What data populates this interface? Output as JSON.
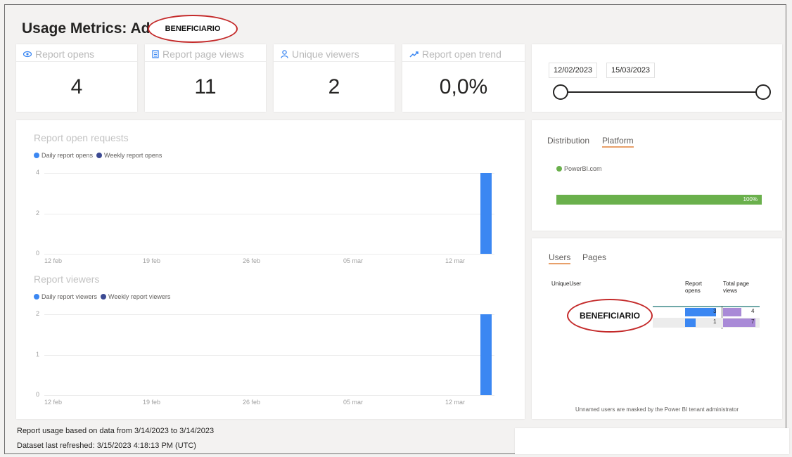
{
  "header": {
    "title": "Usage Metrics: Ad",
    "redaction_label": "BENEFICIARIO"
  },
  "kpis": [
    {
      "label": "Report opens",
      "icon": "eye-icon",
      "value": "4"
    },
    {
      "label": "Report page views",
      "icon": "page-icon",
      "value": "11"
    },
    {
      "label": "Unique viewers",
      "icon": "person-icon",
      "value": "2"
    },
    {
      "label": "Report open trend",
      "icon": "trend-icon",
      "value": "0,0%"
    }
  ],
  "date_slicer": {
    "start": "12/02/2023",
    "end": "15/03/2023"
  },
  "platform_card": {
    "tabs": [
      "Distribution",
      "Platform"
    ],
    "active_tab": "Platform",
    "legend_item": "PowerBI.com",
    "bar_value_label": "100%",
    "bar_fraction": 1.0,
    "bar_color": "#6ab04c"
  },
  "users_card": {
    "tabs": [
      "Users",
      "Pages"
    ],
    "active_tab": "Users",
    "columns": [
      "UniqueUser",
      "Report opens",
      "Total page views"
    ],
    "rows": [
      {
        "user": "BENEFICIARIO",
        "report_opens": "3",
        "total_page_views": "4"
      },
      {
        "user": "",
        "report_opens": "1",
        "total_page_views": "7"
      }
    ],
    "footer_note": "Unnamed users are masked by the Power BI tenant administrator"
  },
  "colors": {
    "daily": "#3b87f2",
    "weekly": "#3c4a93",
    "pageviews": "#a98ad7",
    "accent_tab": "#e8a06a",
    "redaction": "#c42a2a"
  },
  "chart_data": [
    {
      "type": "bar",
      "title": "Report open requests",
      "legend": [
        "Daily report opens",
        "Weekly report opens"
      ],
      "x_ticks": [
        "12 feb",
        "19 feb",
        "26 feb",
        "05 mar",
        "12 mar"
      ],
      "y_ticks": [
        "0",
        "2",
        "4"
      ],
      "ylim": [
        0,
        4
      ],
      "series": [
        {
          "name": "Daily report opens",
          "x": "14 mar",
          "values": [
            4
          ]
        }
      ]
    },
    {
      "type": "bar",
      "title": "Report viewers",
      "legend": [
        "Daily report viewers",
        "Weekly report viewers"
      ],
      "x_ticks": [
        "12 feb",
        "19 feb",
        "26 feb",
        "05 mar",
        "12 mar"
      ],
      "y_ticks": [
        "0",
        "1",
        "2"
      ],
      "ylim": [
        0,
        2
      ],
      "series": [
        {
          "name": "Daily report viewers",
          "x": "14 mar",
          "values": [
            2
          ]
        }
      ]
    }
  ],
  "footer": {
    "line1": "Report usage based on data from 3/14/2023 to 3/14/2023",
    "line2": "Dataset last refreshed: 3/15/2023 4:18:13 PM (UTC)"
  }
}
